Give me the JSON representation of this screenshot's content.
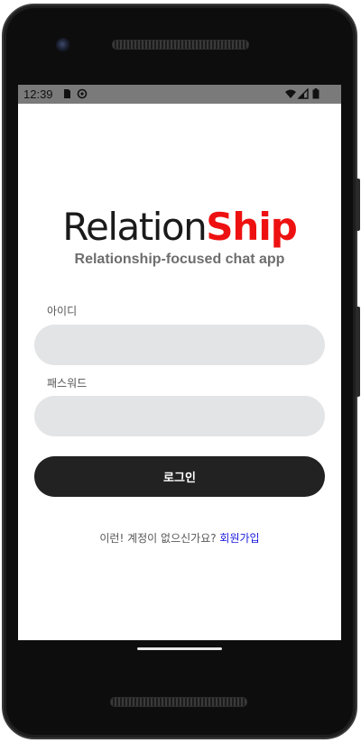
{
  "status_bar": {
    "time": "12:39",
    "icons": [
      "sd-card-icon",
      "sync-icon",
      "wifi-icon",
      "signal-icon",
      "battery-icon"
    ]
  },
  "logo": {
    "part1": "Relation",
    "part2": "Ship"
  },
  "tagline": "Relationship-focused chat app",
  "form": {
    "id_label": "아이디",
    "id_value": "",
    "password_label": "패스워드",
    "password_value": "",
    "login_label": "로그인"
  },
  "signup": {
    "prompt": "이런! 계정이 없으신가요? ",
    "link_label": "회원가입"
  },
  "colors": {
    "brand_red": "#ee1111",
    "button_dark": "#222222",
    "input_bg": "#e3e4e6",
    "link_blue": "#1a1ae0"
  }
}
